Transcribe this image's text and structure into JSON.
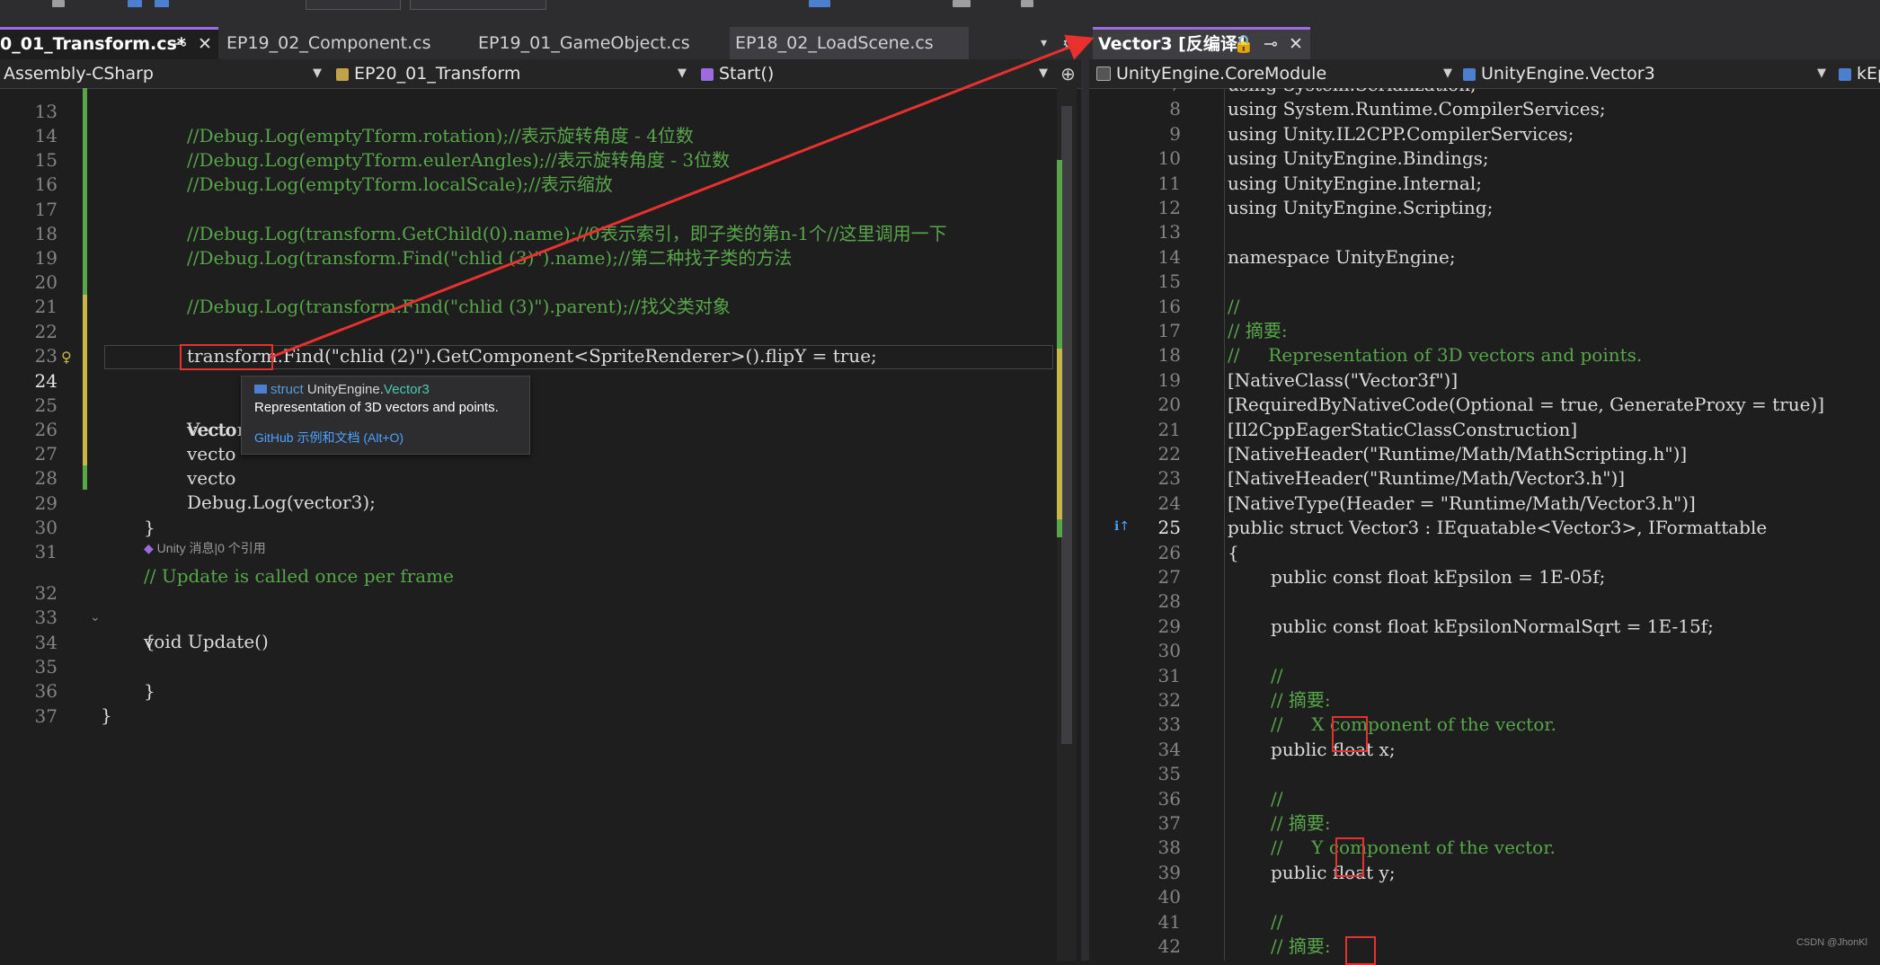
{
  "tabs_left": [
    {
      "label": "0_01_Transform.cs*",
      "active": true
    },
    {
      "label": "EP19_02_Component.cs"
    },
    {
      "label": "EP19_01_GameObject.cs"
    },
    {
      "label": "EP18_02_LoadScene.cs"
    }
  ],
  "tab_right": {
    "label": "Vector3 [反编译]"
  },
  "nav_left": {
    "project": "Assembly-CSharp",
    "class": "EP20_01_Transform",
    "method": "Start()"
  },
  "nav_right": {
    "module": "UnityEngine.CoreModule",
    "type": "UnityEngine.Vector3",
    "member": "kEp"
  },
  "tooltip": {
    "kind": "struct",
    "name_prefix": "UnityEngine.",
    "name": "Vector3",
    "desc": "Representation of 3D vectors and points.",
    "link": "GitHub 示例和文档 (Alt+O)"
  },
  "left_lines": [
    {
      "n": "13",
      "text": "//Debug.Log(emptyTform.rotation);//表示旋转角度 - 4位数"
    },
    {
      "n": "14",
      "text": "//Debug.Log(emptyTform.eulerAngles);//表示旋转角度 - 3位数"
    },
    {
      "n": "15",
      "text": "//Debug.Log(emptyTform.localScale);//表示缩放"
    },
    {
      "n": "16",
      "text": ""
    },
    {
      "n": "17",
      "text": "//Debug.Log(transform.GetChild(0).name);//0表示索引，即子类的第n-1个//这里调用一下"
    },
    {
      "n": "18",
      "text": "//Debug.Log(transform.Find(\"chlid (3)\").name);//第二种找子类的方法"
    },
    {
      "n": "19",
      "text": ""
    },
    {
      "n": "20",
      "text": "//Debug.Log(transform.Find(\"chlid (3)\").parent);//找父类对象"
    },
    {
      "n": "21",
      "text": ""
    },
    {
      "n": "22",
      "text": "transform.Find(\"chlid (2)\").GetComponent<SpriteRenderer>().flipY = true;"
    },
    {
      "n": "23",
      "text": ""
    },
    {
      "n": "24",
      "text": "Vector3 vector3 = new Vector3();"
    },
    {
      "n": "25",
      "text": "vecto"
    },
    {
      "n": "26",
      "text": "vecto"
    },
    {
      "n": "27",
      "text": "vecto"
    },
    {
      "n": "28",
      "text": "Debug.Log(vector3);"
    },
    {
      "n": "29",
      "text": "}"
    },
    {
      "n": "30",
      "text": ""
    },
    {
      "n": "31",
      "text": "// Update is called once per frame"
    },
    {
      "n": "32",
      "text": "void Update()"
    },
    {
      "n": "33",
      "text": "{"
    },
    {
      "n": "34",
      "text": ""
    },
    {
      "n": "35",
      "text": "}"
    },
    {
      "n": "36",
      "text": "}"
    },
    {
      "n": "37",
      "text": ""
    }
  ],
  "codelens": "Unity 消息|0 个引用",
  "right_lines": [
    {
      "n": "7",
      "text": "using System.Serialization;"
    },
    {
      "n": "8",
      "text": "using System.Runtime.CompilerServices;"
    },
    {
      "n": "9",
      "text": "using Unity.IL2CPP.CompilerServices;"
    },
    {
      "n": "10",
      "text": "using UnityEngine.Bindings;"
    },
    {
      "n": "11",
      "text": "using UnityEngine.Internal;"
    },
    {
      "n": "12",
      "text": "using UnityEngine.Scripting;"
    },
    {
      "n": "13",
      "text": ""
    },
    {
      "n": "14",
      "text": "namespace UnityEngine;"
    },
    {
      "n": "15",
      "text": ""
    },
    {
      "n": "16",
      "text": "//"
    },
    {
      "n": "17",
      "text": "// 摘要:"
    },
    {
      "n": "18",
      "text": "//     Representation of 3D vectors and points."
    },
    {
      "n": "19",
      "text": "[NativeClass(\"Vector3f\")]"
    },
    {
      "n": "20",
      "text": "[RequiredByNativeCode(Optional = true, GenerateProxy = true)]"
    },
    {
      "n": "21",
      "text": "[Il2CppEagerStaticClassConstruction]"
    },
    {
      "n": "22",
      "text": "[NativeHeader(\"Runtime/Math/MathScripting.h\")]"
    },
    {
      "n": "23",
      "text": "[NativeHeader(\"Runtime/Math/Vector3.h\")]"
    },
    {
      "n": "24",
      "text": "[NativeType(Header = \"Runtime/Math/Vector3.h\")]"
    },
    {
      "n": "25",
      "text": "public struct Vector3 : IEquatable<Vector3>, IFormattable"
    },
    {
      "n": "26",
      "text": "{"
    },
    {
      "n": "27",
      "text": "public const float kEpsilon = 1E-05f;"
    },
    {
      "n": "28",
      "text": ""
    },
    {
      "n": "29",
      "text": "public const float kEpsilonNormalSqrt = 1E-15f;"
    },
    {
      "n": "30",
      "text": ""
    },
    {
      "n": "31",
      "text": "//"
    },
    {
      "n": "32",
      "text": "// 摘要:"
    },
    {
      "n": "33",
      "text": "//     X component of the vector."
    },
    {
      "n": "34",
      "text": "public float x;"
    },
    {
      "n": "35",
      "text": ""
    },
    {
      "n": "36",
      "text": "//"
    },
    {
      "n": "37",
      "text": "// 摘要:"
    },
    {
      "n": "38",
      "text": "//     Y component of the vector."
    },
    {
      "n": "39",
      "text": "public float y;"
    },
    {
      "n": "40",
      "text": ""
    },
    {
      "n": "41",
      "text": "//"
    },
    {
      "n": "42",
      "text": "// 摘要:"
    }
  ],
  "watermark": "CSDN @JhonKl",
  "colors": {
    "accent": "#9b6bdf",
    "annotation": "#e8312f",
    "comment": "#57a64a",
    "keyword": "#569cd6",
    "type": "#4ec9b0",
    "string": "#d69d85"
  }
}
